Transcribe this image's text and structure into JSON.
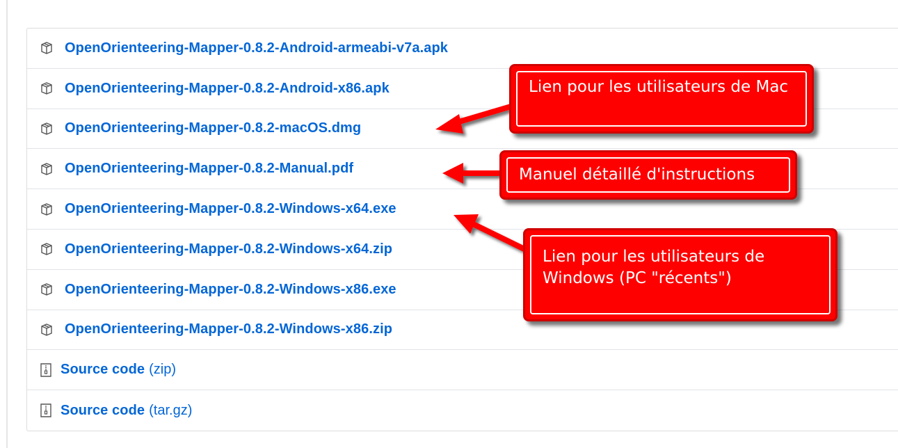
{
  "assets": [
    {
      "label": "OpenOrienteering-Mapper-0.8.2-Android-armeabi-v7a.apk",
      "icon": "package-icon"
    },
    {
      "label": "OpenOrienteering-Mapper-0.8.2-Android-x86.apk",
      "icon": "package-icon"
    },
    {
      "label": "OpenOrienteering-Mapper-0.8.2-macOS.dmg",
      "icon": "package-icon"
    },
    {
      "label": "OpenOrienteering-Mapper-0.8.2-Manual.pdf",
      "icon": "package-icon"
    },
    {
      "label": "OpenOrienteering-Mapper-0.8.2-Windows-x64.exe",
      "icon": "package-icon"
    },
    {
      "label": "OpenOrienteering-Mapper-0.8.2-Windows-x64.zip",
      "icon": "package-icon"
    },
    {
      "label": "OpenOrienteering-Mapper-0.8.2-Windows-x86.exe",
      "icon": "package-icon"
    },
    {
      "label": "OpenOrienteering-Mapper-0.8.2-Windows-x86.zip",
      "icon": "package-icon"
    }
  ],
  "sources": [
    {
      "label": "Source code",
      "format": "(zip)",
      "icon": "file-zip-icon"
    },
    {
      "label": "Source code",
      "format": "(tar.gz)",
      "icon": "file-zip-icon"
    }
  ],
  "callouts": {
    "mac": "Lien pour les utilisateurs de Mac",
    "manual": "Manuel détaillé d'instructions",
    "windows": "Lien pour les utilisateurs de Windows (PC \"récents\")"
  },
  "colors": {
    "link": "#0366d6",
    "callout": "#ff0000"
  }
}
